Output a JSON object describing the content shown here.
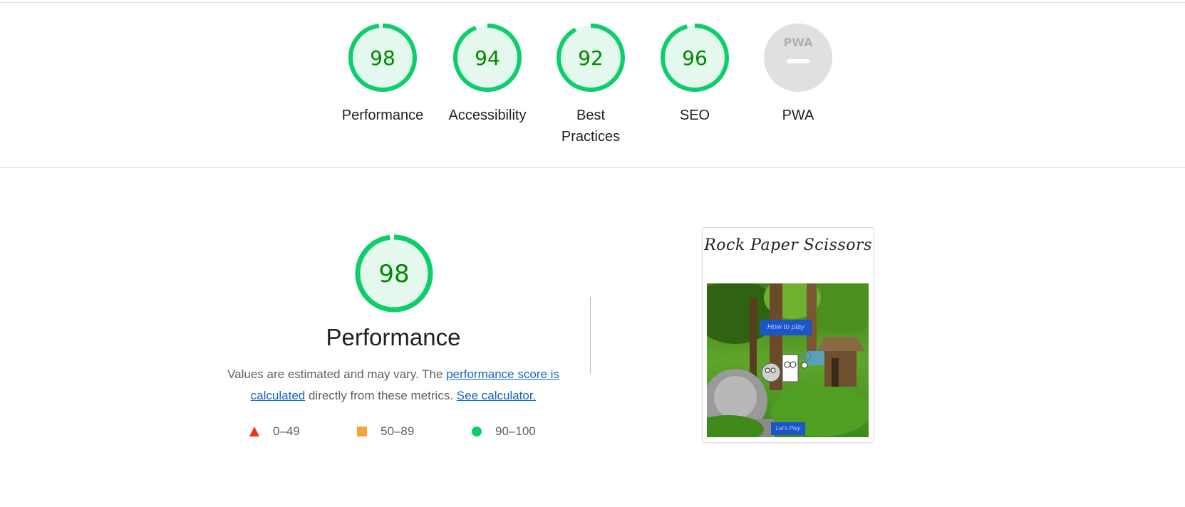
{
  "categories": [
    {
      "label": "Performance",
      "score": "98",
      "value": 98
    },
    {
      "label": "Accessibility",
      "score": "94",
      "value": 94
    },
    {
      "label": "Best Practices",
      "score": "92",
      "value": 92
    },
    {
      "label": "SEO",
      "score": "96",
      "value": 96
    },
    {
      "label": "PWA",
      "score": "",
      "value": null,
      "badge": "PWA"
    }
  ],
  "performance": {
    "score": "98",
    "value": 98,
    "title": "Performance",
    "desc_prefix": "Values are estimated and may vary. The ",
    "link_score": "performance score is calculated",
    "desc_middle": " directly from these metrics. ",
    "link_calculator": "See calculator."
  },
  "legend": [
    {
      "range": "0–49",
      "shape": "triangle",
      "color": "#eb3323"
    },
    {
      "range": "50–89",
      "shape": "square",
      "color": "#f4a43a"
    },
    {
      "range": "90–100",
      "shape": "circle",
      "color": "#0cce6b"
    }
  ],
  "screenshot": {
    "title": "Rock Paper Scissors",
    "how_button": "How to play",
    "play_button": "Let's Play"
  },
  "colors": {
    "pass_ring": "#0cce6b",
    "pass_fill": "#e5f8ed",
    "pass_text": "#008800",
    "na_fill": "#e0e0e0",
    "na_text": "#b0b0b0"
  }
}
